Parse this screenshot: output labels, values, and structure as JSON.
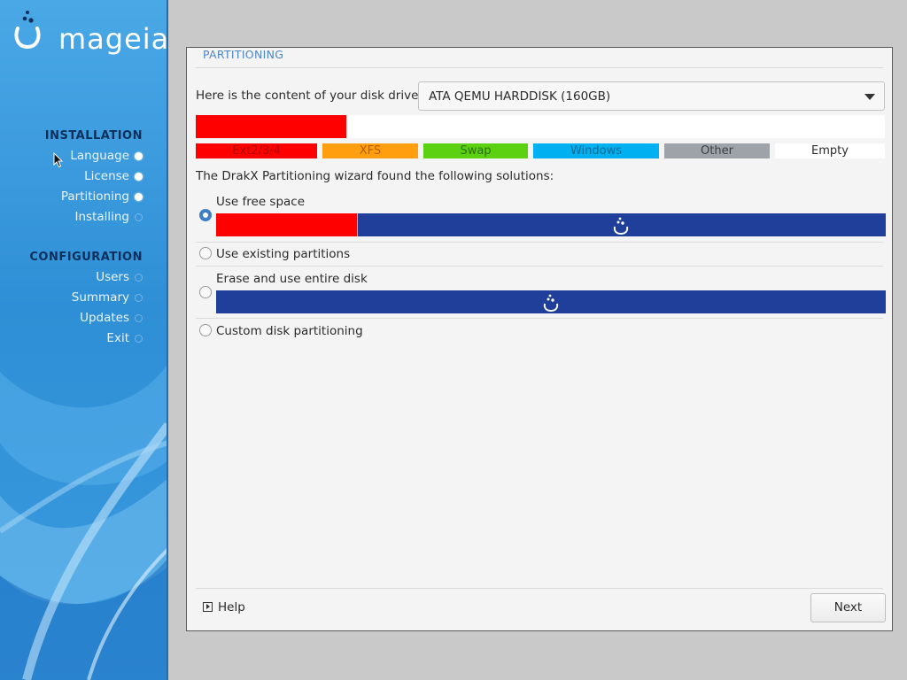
{
  "brand": {
    "logo_text": "mageia"
  },
  "sidebar": {
    "installation": {
      "heading": "INSTALLATION",
      "items": [
        {
          "label": "Language",
          "state": "done"
        },
        {
          "label": "License",
          "state": "done"
        },
        {
          "label": "Partitioning",
          "state": "current"
        },
        {
          "label": "Installing",
          "state": "inactive"
        }
      ]
    },
    "configuration": {
      "heading": "CONFIGURATION",
      "items": [
        {
          "label": "Users",
          "state": "inactive"
        },
        {
          "label": "Summary",
          "state": "inactive"
        },
        {
          "label": "Updates",
          "state": "inactive"
        },
        {
          "label": "Exit",
          "state": "inactive"
        }
      ]
    }
  },
  "main": {
    "section_title": "PARTITIONING",
    "disk_label": "Here is the content of your disk drive",
    "disk_select": {
      "value": "ATA QEMU HARDDISK (160GB)"
    },
    "legend": [
      {
        "label": "Ext2/3/4",
        "color": "#ff0000"
      },
      {
        "label": "XFS",
        "color": "#ff9f0f"
      },
      {
        "label": "Swap",
        "color": "#5bd111"
      },
      {
        "label": "Windows",
        "color": "#00b0f0"
      },
      {
        "label": "Other",
        "color": "#9ea3aa"
      },
      {
        "label": "Empty",
        "color": "#ffffff"
      }
    ],
    "wizard_text": "The DrakX Partitioning wizard found the following solutions:",
    "options": [
      {
        "label": "Use free space",
        "selected": true
      },
      {
        "label": "Use existing partitions",
        "selected": false
      },
      {
        "label": "Erase and use entire disk",
        "selected": false
      },
      {
        "label": "Custom disk partitioning",
        "selected": false
      }
    ]
  },
  "footer": {
    "help_label": "Help",
    "next_label": "Next"
  },
  "colors": {
    "accent": "#3c7fc4",
    "new_partition": "#1f3f9a",
    "ext": "#ff0000"
  }
}
